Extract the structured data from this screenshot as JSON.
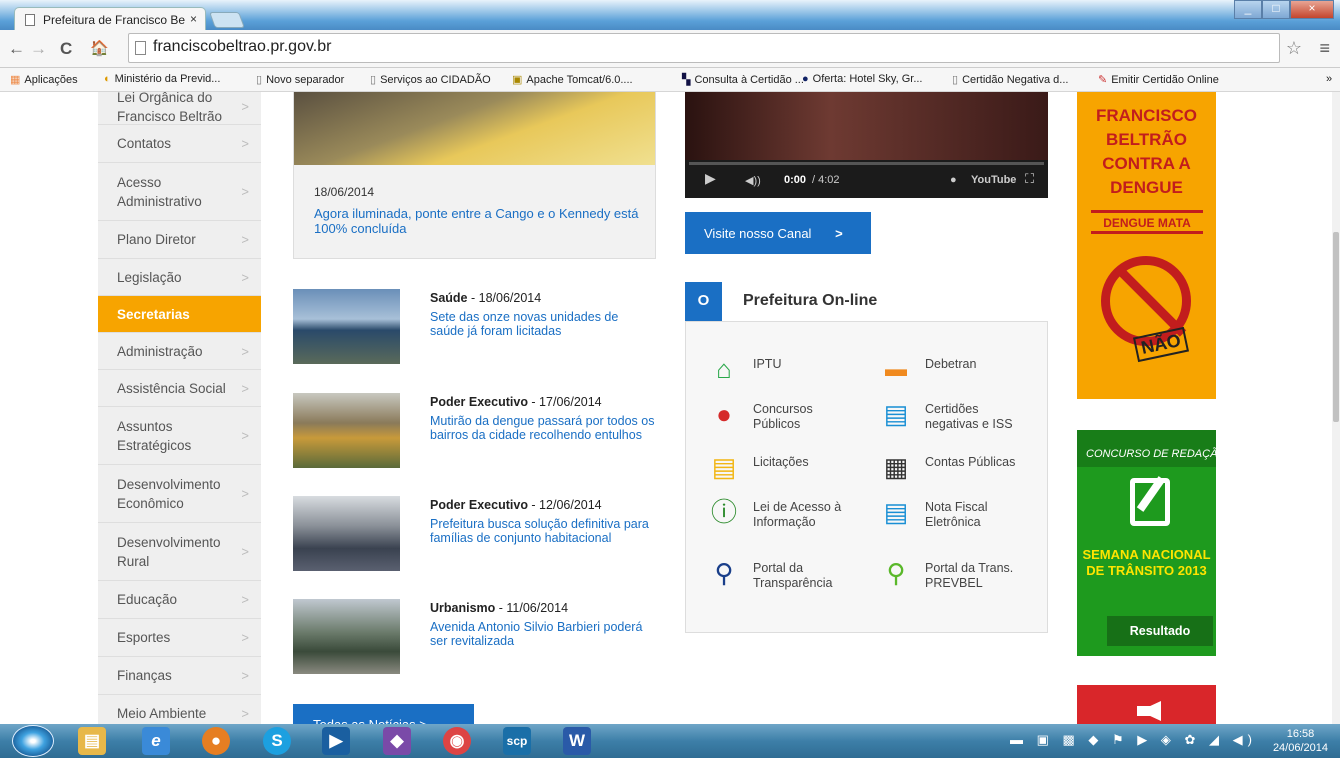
{
  "browser": {
    "tab_title": "Prefeitura de Francisco Be",
    "tab_close": "×",
    "window_title_faded": "",
    "url": "franciscobeltrao.pr.gov.br",
    "star": "☆",
    "menu": "≡",
    "nav": {
      "back": "←",
      "forward": "→",
      "reload": "C",
      "home": "🏠"
    },
    "bookmarks": [
      {
        "label": "Aplicações",
        "icon": "apps-icon"
      },
      {
        "label": "Ministério da Previd...",
        "icon": "ministerio-icon"
      },
      {
        "label": "Novo separador",
        "icon": "page-icon"
      },
      {
        "label": "Serviços ao CIDADÃO",
        "icon": "page-icon"
      },
      {
        "label": "Apache Tomcat/6.0....",
        "icon": "tomcat-icon"
      },
      {
        "label": "Consulta à Certidão ...",
        "icon": "receita-icon"
      },
      {
        "label": "Oferta: Hotel Sky, Gr...",
        "icon": "hu-icon"
      },
      {
        "label": "Certidão Negativa d...",
        "icon": "page-icon"
      },
      {
        "label": "Emitir Certidão Online",
        "icon": "handshake-icon"
      }
    ],
    "bookmarks_more": "»"
  },
  "sidebar": {
    "items": [
      {
        "label": "Lei Orgânica do Francisco Beltrão",
        "active": false
      },
      {
        "label": "Contatos",
        "active": false
      },
      {
        "label": "Acesso Administrativo",
        "active": false
      },
      {
        "label": "Plano Diretor",
        "active": false
      },
      {
        "label": "Legislação",
        "active": false
      },
      {
        "label": "Secretarias",
        "active": true
      },
      {
        "label": "Administração",
        "active": false
      },
      {
        "label": "Assistência Social",
        "active": false
      },
      {
        "label": "Assuntos Estratégicos",
        "active": false
      },
      {
        "label": "Desenvolvimento Econômico",
        "active": false
      },
      {
        "label": "Desenvolvimento Rural",
        "active": false
      },
      {
        "label": "Educação",
        "active": false
      },
      {
        "label": "Esportes",
        "active": false
      },
      {
        "label": "Finanças",
        "active": false
      },
      {
        "label": "Meio Ambiente",
        "active": false
      }
    ],
    "chevron": ">"
  },
  "featured": {
    "date": "18/06/2014",
    "title": "Agora iluminada, ponte entre a Cango e o Kennedy está 100% concluída"
  },
  "news": [
    {
      "category": "Saúde",
      "date": " - 18/06/2014",
      "title": "Sete das onze novas unidades de saúde já foram licitadas"
    },
    {
      "category": "Poder Executivo",
      "date": " - 17/06/2014",
      "title": "Mutirão da dengue passará por todos os bairros da cidade recolhendo entulhos"
    },
    {
      "category": "Poder Executivo",
      "date": " - 12/06/2014",
      "title": "Prefeitura busca solução definitiva para famílias de conjunto habitacional"
    },
    {
      "category": "Urbanismo",
      "date": " - 11/06/2014",
      "title": "Avenida Antonio Silvio Barbieri poderá ser revitalizada"
    }
  ],
  "all_news_button": "Todas as Notícias   >",
  "video": {
    "time": "0:00",
    "duration": " / 4:02",
    "brand": "YouTube",
    "play": "▶",
    "volume": "◀))",
    "fullscreen": "⛶",
    "settings": "●"
  },
  "canal_button": "Visite nosso Canal",
  "canal_arrow": ">",
  "online": {
    "header_icon": "O",
    "title": "Prefeitura On-line",
    "items": [
      {
        "label": "IPTU",
        "icon": "house-icon",
        "color": "#2aa84a"
      },
      {
        "label": "Debetran",
        "icon": "car-icon",
        "color": "#f08a1f"
      },
      {
        "label": "Concursos Públicos",
        "icon": "person-icon",
        "color": "#d52b2b"
      },
      {
        "label": "Certidões negativas e ISS",
        "icon": "document-icon",
        "color": "#1a8fd4"
      },
      {
        "label": "Licitações",
        "icon": "list-icon",
        "color": "#f2b614"
      },
      {
        "label": "Contas Públicas",
        "icon": "calculator-icon",
        "color": "#333333"
      },
      {
        "label": "Lei de Acesso à Informação",
        "icon": "info-icon",
        "color": "#2a8a2a"
      },
      {
        "label": "Nota Fiscal Eletrônica",
        "icon": "invoice-icon",
        "color": "#1a8fd4"
      },
      {
        "label": "Portal da Transparência",
        "icon": "search-icon",
        "color": "#1a3f8a"
      },
      {
        "label": "Portal da Trans. PREVBEL",
        "icon": "search-money-icon",
        "color": "#5ab82a"
      }
    ]
  },
  "banners": {
    "dengue_title": "FRANCISCO BELTRÃO CONTRA A DENGUE",
    "dengue_mata": "DENGUE MATA",
    "dengue_nao": "NÃO",
    "dengue_small": "DENGUE",
    "redacao_header": "CONCURSO DE REDAÇÃO",
    "redacao_semana": "SEMANA NACIONAL DE TRÂNSITO 2013",
    "redacao_button": "Resultado"
  },
  "taskbar": {
    "time": "16:58",
    "date": "24/06/2014",
    "apps": [
      {
        "name": "explorer",
        "glyph": "▤",
        "color": "#e7b84a"
      },
      {
        "name": "internet-explorer",
        "glyph": "e",
        "color": "#3a8ad8"
      },
      {
        "name": "firefox",
        "glyph": "●",
        "color": "#e67e22"
      },
      {
        "name": "skype",
        "glyph": "S",
        "color": "#1ca0e0"
      },
      {
        "name": "media",
        "glyph": "▶",
        "color": "#1a5fa0"
      },
      {
        "name": "winrar",
        "glyph": "◆",
        "color": "#7a4aa8"
      },
      {
        "name": "chrome",
        "glyph": "◉",
        "color": "#d44"
      },
      {
        "name": "scp",
        "glyph": "scp",
        "color": "#1a6fa8"
      },
      {
        "name": "word",
        "glyph": "W",
        "color": "#2a5aa8"
      }
    ],
    "tray_icons": "▬ ▣ ▩ ◆ ⚑ ▶ ◈ ✿ ◢ ◀)"
  }
}
